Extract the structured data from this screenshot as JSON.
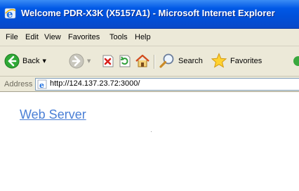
{
  "window": {
    "title": "Welcome PDR-X3K (X5157A1) - Microsoft Internet Explorer",
    "icon": "ie-icon"
  },
  "menu": {
    "items": [
      {
        "label": "File"
      },
      {
        "label": "Edit"
      },
      {
        "label": "View"
      },
      {
        "label": "Favorites"
      },
      {
        "label": "Tools"
      },
      {
        "label": "Help"
      }
    ]
  },
  "toolbar": {
    "back_label": "Back",
    "search_label": "Search",
    "favorites_label": "Favorites"
  },
  "address": {
    "label": "Address",
    "url": "http://124.137.23.72:3000/"
  },
  "content": {
    "link_text": "Web Server"
  },
  "colors": {
    "titlebar": "#0058e6",
    "chrome": "#ece9d8",
    "link": "#4a7fd6"
  }
}
